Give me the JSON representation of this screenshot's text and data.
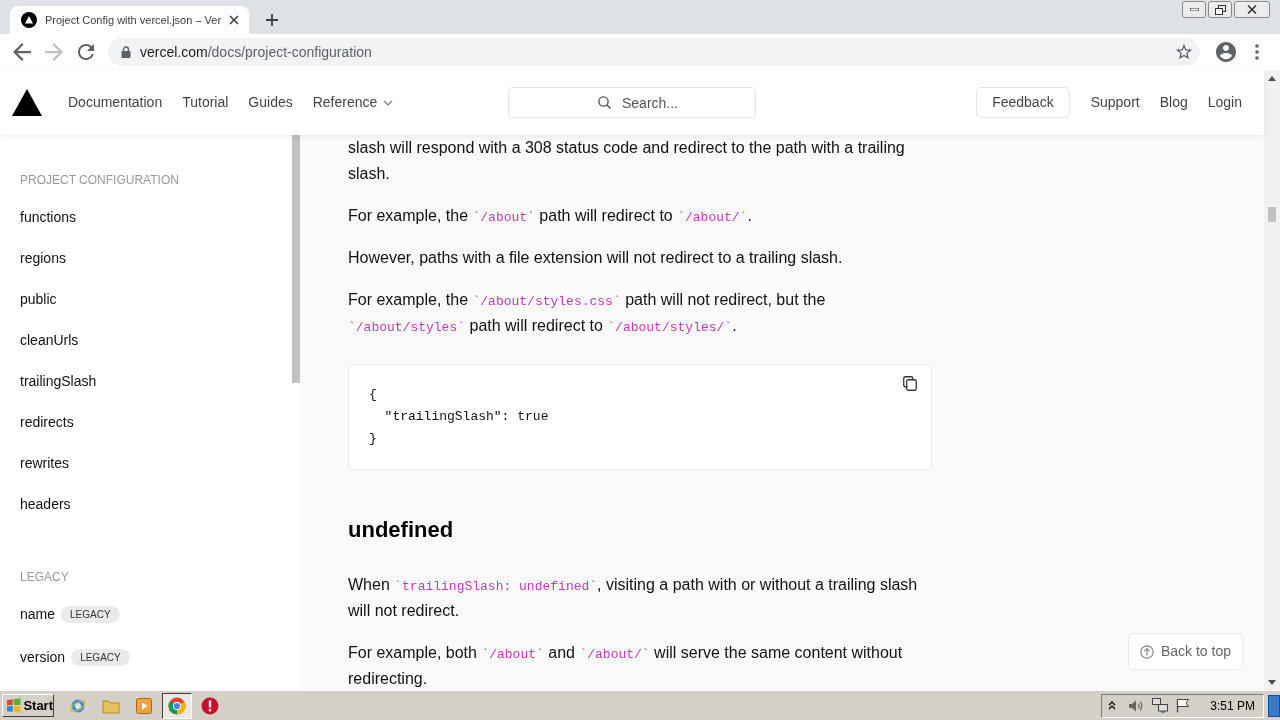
{
  "browser": {
    "tab": {
      "title": "Project Config with vercel.json – Ver",
      "selected": true
    },
    "forward_disabled": true,
    "address": {
      "domain": "vercel.com",
      "path": "/docs/project-configuration"
    }
  },
  "navbar": {
    "links": [
      {
        "label": "Documentation",
        "dropdown": false
      },
      {
        "label": "Tutorial",
        "dropdown": false
      },
      {
        "label": "Guides",
        "dropdown": false
      },
      {
        "label": "Reference",
        "dropdown": true
      }
    ],
    "search": {
      "placeholder": "Search..."
    },
    "actions": [
      {
        "label": "Feedback",
        "kind": "button"
      },
      {
        "label": "Support",
        "kind": "link"
      },
      {
        "label": "Blog",
        "kind": "link"
      },
      {
        "label": "Login",
        "kind": "link"
      }
    ]
  },
  "sidebar": {
    "sections": [
      {
        "heading": "PROJECT CONFIGURATION",
        "items": [
          {
            "label": "functions"
          },
          {
            "label": "regions"
          },
          {
            "label": "public"
          },
          {
            "label": "cleanUrls"
          },
          {
            "label": "trailingSlash"
          },
          {
            "label": "redirects"
          },
          {
            "label": "rewrites"
          },
          {
            "label": "headers"
          }
        ]
      },
      {
        "heading": "LEGACY",
        "items": [
          {
            "label": "name",
            "badge": "LEGACY"
          },
          {
            "label": "version",
            "badge": "LEGACY"
          }
        ]
      }
    ]
  },
  "content": [
    {
      "kind": "paragraph",
      "segments": [
        {
          "kind": "text",
          "text": "slash will respond with a 308 status code and redirect to the path with a trailing slash."
        }
      ]
    },
    {
      "kind": "paragraph",
      "segments": [
        {
          "kind": "text",
          "text": "For example, the "
        },
        {
          "kind": "code",
          "text": "`/about`"
        },
        {
          "kind": "text",
          "text": " path will redirect to "
        },
        {
          "kind": "code",
          "text": "`/about/`"
        },
        {
          "kind": "text",
          "text": "."
        }
      ]
    },
    {
      "kind": "paragraph",
      "segments": [
        {
          "kind": "text",
          "text": "However, paths with a file extension will not redirect to a trailing slash."
        }
      ]
    },
    {
      "kind": "paragraph",
      "segments": [
        {
          "kind": "text",
          "text": "For example, the "
        },
        {
          "kind": "code",
          "text": "`/about/styles.css`"
        },
        {
          "kind": "text",
          "text": " path will not redirect, but the "
        },
        {
          "kind": "code",
          "text": "`/about/styles`"
        },
        {
          "kind": "text",
          "text": " path will redirect to "
        },
        {
          "kind": "code",
          "text": "`/about/styles/`"
        },
        {
          "kind": "text",
          "text": "."
        }
      ]
    },
    {
      "kind": "code_block",
      "lines": [
        "{",
        "  \"trailingSlash\": true",
        "}"
      ]
    },
    {
      "kind": "heading",
      "text": "undefined"
    },
    {
      "kind": "paragraph",
      "segments": [
        {
          "kind": "text",
          "text": "When "
        },
        {
          "kind": "code",
          "text": "`trailingSlash: undefined`"
        },
        {
          "kind": "text",
          "text": ", visiting a path with or without a trailing slash will not redirect."
        }
      ]
    },
    {
      "kind": "paragraph",
      "segments": [
        {
          "kind": "text",
          "text": "For example, both "
        },
        {
          "kind": "code",
          "text": "`/about`"
        },
        {
          "kind": "text",
          "text": " and "
        },
        {
          "kind": "code",
          "text": "`/about/`"
        },
        {
          "kind": "text",
          "text": " will serve the same content without redirecting."
        }
      ]
    }
  ],
  "back_to_top": {
    "label": "Back to top"
  },
  "taskbar": {
    "start": "Start",
    "apps": [
      {
        "kind": "globe",
        "selected": false
      },
      {
        "kind": "folder",
        "selected": false
      },
      {
        "kind": "media",
        "selected": false
      },
      {
        "kind": "chrome",
        "selected": true
      },
      {
        "kind": "alert",
        "selected": false
      }
    ],
    "clock": "3:51 PM"
  }
}
